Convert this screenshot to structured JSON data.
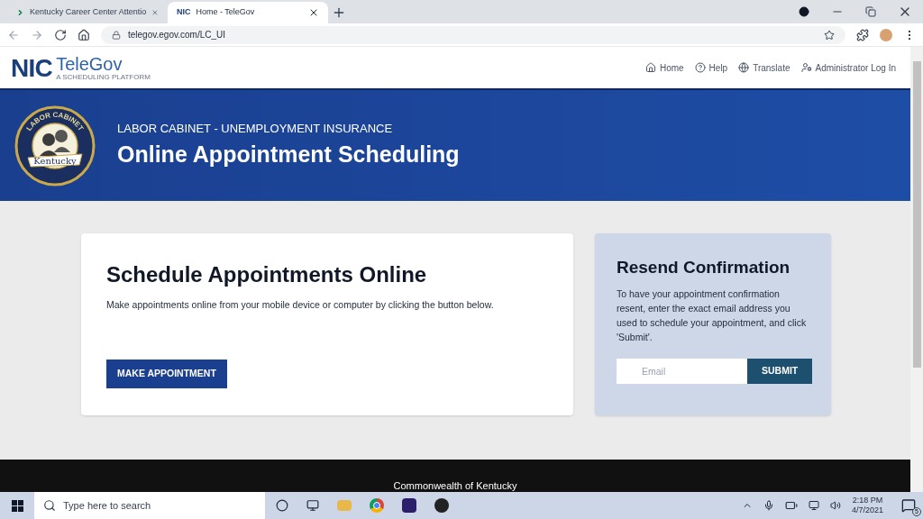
{
  "browser": {
    "tabs": [
      {
        "kind": "chevron",
        "title": "Kentucky Career Center Attentio",
        "selected": false
      },
      {
        "kind": "logo",
        "favicon_text": "NIC",
        "title": "Home - TeleGov",
        "selected": true
      }
    ],
    "url": "telegov.egov.com/LC_UI"
  },
  "site_header": {
    "logo": {
      "mark": "NIC",
      "name": "TeleGov",
      "tagline": "A SCHEDULING PLATFORM"
    },
    "nav": [
      {
        "label": "Home"
      },
      {
        "label": "Help"
      },
      {
        "label": "Translate"
      },
      {
        "label": "Administrator Log In"
      }
    ]
  },
  "banner": {
    "seal": {
      "ring_text": "LABOR CABINET",
      "state_text": "Kentucky"
    },
    "subtitle": "LABOR CABINET - UNEMPLOYMENT INSURANCE",
    "title": "Online Appointment Scheduling"
  },
  "schedule_card": {
    "title": "Schedule Appointments Online",
    "text": "Make appointments online from your mobile device or computer by clicking the button below.",
    "button": "MAKE APPOINTMENT"
  },
  "resend_card": {
    "title": "Resend Confirmation",
    "text": "To have your appointment confirmation resent, enter the exact email address you used to schedule your appointment, and click 'Submit'.",
    "email": {
      "placeholder": "Email"
    },
    "button": "SUBMIT"
  },
  "footer": {
    "text": "Commonwealth of Kentucky"
  },
  "taskbar": {
    "search": {
      "placeholder": "Type here to search"
    },
    "time": "2:18 PM",
    "date": "4/7/2021",
    "notifications": "5"
  }
}
